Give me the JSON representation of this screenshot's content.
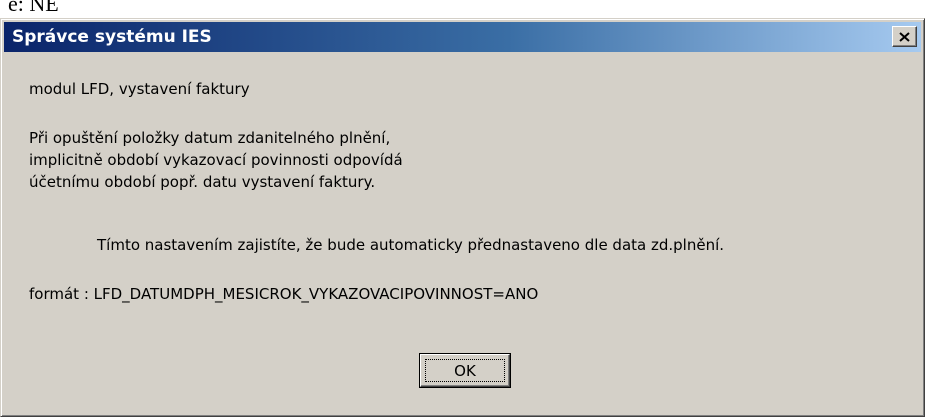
{
  "above_text": "e: NE",
  "dialog": {
    "title": "Správce systému IES",
    "close_icon": "close-x-icon",
    "message_lines": [
      "modul LFD, vystavení faktury",
      "Při opuštění položky datum zdanitelného plnění,",
      "implicitně období vykazovací povinnosti odpovídá",
      "účetnímu období popř. datu vystavení faktury.",
      "Tímto nastavením zajistíte, že bude automaticky přednastaveno dle data zd.plnění.",
      "formát : LFD_DATUMDPH_MESICROK_VYKAZOVACIPOVINNOST=ANO"
    ],
    "ok_label": "OK"
  },
  "colors": {
    "titlebar_start": "#0a246a",
    "titlebar_end": "#a6caf0",
    "dialog_background": "#d4d0c8"
  }
}
